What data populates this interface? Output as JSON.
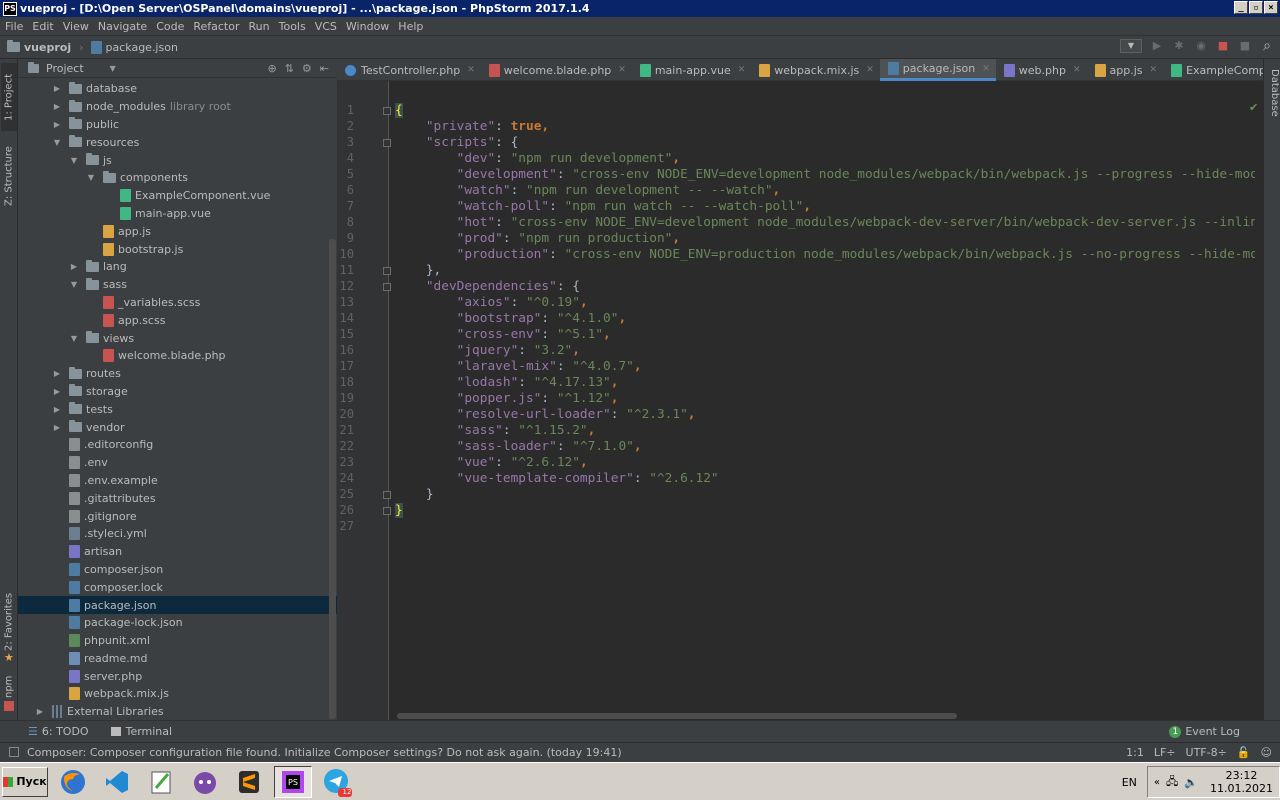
{
  "window": {
    "app_icon_text": "PS",
    "title": "vueproj - [D:\\Open Server\\OSPanel\\domains\\vueproj] - ...\\package.json - PhpStorm 2017.1.4",
    "btn_min": "_",
    "btn_restore": "▫",
    "btn_close": "×"
  },
  "menu": [
    "File",
    "Edit",
    "View",
    "Navigate",
    "Code",
    "Refactor",
    "Run",
    "Tools",
    "VCS",
    "Window",
    "Help"
  ],
  "breadcrumb": {
    "project": "vueproj",
    "file": "package.json"
  },
  "left_tabs": {
    "project": "1: Project",
    "structure": "Z: Structure",
    "favorites": "2: Favorites",
    "npm": "npm"
  },
  "right_tabs": {
    "database": "Database"
  },
  "project_panel": {
    "title": "Project"
  },
  "tree": [
    {
      "label": "database",
      "hint": "",
      "type": "folder",
      "depth": 1,
      "arrow": "▶"
    },
    {
      "label": "node_modules",
      "hint": "library root",
      "type": "folder",
      "depth": 1,
      "arrow": "▶"
    },
    {
      "label": "public",
      "hint": "",
      "type": "folder",
      "depth": 1,
      "arrow": "▶"
    },
    {
      "label": "resources",
      "hint": "",
      "type": "folder",
      "depth": 1,
      "arrow": "▼"
    },
    {
      "label": "js",
      "hint": "",
      "type": "folder",
      "depth": 2,
      "arrow": "▼"
    },
    {
      "label": "components",
      "hint": "",
      "type": "folder",
      "depth": 3,
      "arrow": "▼"
    },
    {
      "label": "ExampleComponent.vue",
      "hint": "",
      "type": "vue",
      "depth": 4,
      "arrow": ""
    },
    {
      "label": "main-app.vue",
      "hint": "",
      "type": "vue",
      "depth": 4,
      "arrow": ""
    },
    {
      "label": "app.js",
      "hint": "",
      "type": "js",
      "depth": 3,
      "arrow": ""
    },
    {
      "label": "bootstrap.js",
      "hint": "",
      "type": "js",
      "depth": 3,
      "arrow": ""
    },
    {
      "label": "lang",
      "hint": "",
      "type": "folder",
      "depth": 2,
      "arrow": "▶"
    },
    {
      "label": "sass",
      "hint": "",
      "type": "folder",
      "depth": 2,
      "arrow": "▼"
    },
    {
      "label": "_variables.scss",
      "hint": "",
      "type": "scss",
      "depth": 3,
      "arrow": ""
    },
    {
      "label": "app.scss",
      "hint": "",
      "type": "scss",
      "depth": 3,
      "arrow": ""
    },
    {
      "label": "views",
      "hint": "",
      "type": "folder",
      "depth": 2,
      "arrow": "▼"
    },
    {
      "label": "welcome.blade.php",
      "hint": "",
      "type": "blade",
      "depth": 3,
      "arrow": ""
    },
    {
      "label": "routes",
      "hint": "",
      "type": "folder",
      "depth": 1,
      "arrow": "▶"
    },
    {
      "label": "storage",
      "hint": "",
      "type": "folder",
      "depth": 1,
      "arrow": "▶"
    },
    {
      "label": "tests",
      "hint": "",
      "type": "folder",
      "depth": 1,
      "arrow": "▶"
    },
    {
      "label": "vendor",
      "hint": "",
      "type": "folder",
      "depth": 1,
      "arrow": "▶"
    },
    {
      "label": ".editorconfig",
      "hint": "",
      "type": "text",
      "depth": 1,
      "arrow": ""
    },
    {
      "label": ".env",
      "hint": "",
      "type": "text",
      "depth": 1,
      "arrow": ""
    },
    {
      "label": ".env.example",
      "hint": "",
      "type": "text",
      "depth": 1,
      "arrow": ""
    },
    {
      "label": ".gitattributes",
      "hint": "",
      "type": "text",
      "depth": 1,
      "arrow": ""
    },
    {
      "label": ".gitignore",
      "hint": "",
      "type": "text",
      "depth": 1,
      "arrow": ""
    },
    {
      "label": ".styleci.yml",
      "hint": "",
      "type": "yml",
      "depth": 1,
      "arrow": ""
    },
    {
      "label": "artisan",
      "hint": "",
      "type": "php",
      "depth": 1,
      "arrow": ""
    },
    {
      "label": "composer.json",
      "hint": "",
      "type": "json",
      "depth": 1,
      "arrow": ""
    },
    {
      "label": "composer.lock",
      "hint": "",
      "type": "json",
      "depth": 1,
      "arrow": ""
    },
    {
      "label": "package.json",
      "hint": "",
      "type": "json",
      "depth": 1,
      "arrow": "",
      "selected": true
    },
    {
      "label": "package-lock.json",
      "hint": "",
      "type": "json",
      "depth": 1,
      "arrow": ""
    },
    {
      "label": "phpunit.xml",
      "hint": "",
      "type": "xml",
      "depth": 1,
      "arrow": ""
    },
    {
      "label": "readme.md",
      "hint": "",
      "type": "md",
      "depth": 1,
      "arrow": ""
    },
    {
      "label": "server.php",
      "hint": "",
      "type": "php",
      "depth": 1,
      "arrow": ""
    },
    {
      "label": "webpack.mix.js",
      "hint": "",
      "type": "js",
      "depth": 1,
      "arrow": ""
    },
    {
      "label": "External Libraries",
      "hint": "",
      "type": "lib",
      "depth": 0,
      "arrow": "▶"
    }
  ],
  "editor_tabs": [
    {
      "label": "TestController.php",
      "type": "class"
    },
    {
      "label": "welcome.blade.php",
      "type": "blade"
    },
    {
      "label": "main-app.vue",
      "type": "vue"
    },
    {
      "label": "webpack.mix.js",
      "type": "js"
    },
    {
      "label": "package.json",
      "type": "json",
      "active": true
    },
    {
      "label": "web.php",
      "type": "php"
    },
    {
      "label": "app.js",
      "type": "js"
    },
    {
      "label": "ExampleComponent.vue",
      "type": "vue"
    }
  ],
  "code_lines": [
    [
      {
        "t": "{",
        "c": "brace"
      }
    ],
    [
      {
        "t": "    "
      },
      {
        "t": "\"private\"",
        "c": "k"
      },
      {
        "t": ": ",
        "c": "p"
      },
      {
        "t": "true",
        "c": "b"
      },
      {
        "t": ",",
        "c": "b"
      }
    ],
    [
      {
        "t": "    "
      },
      {
        "t": "\"scripts\"",
        "c": "k"
      },
      {
        "t": ": {",
        "c": "p"
      }
    ],
    [
      {
        "t": "        "
      },
      {
        "t": "\"dev\"",
        "c": "k"
      },
      {
        "t": ": ",
        "c": "p"
      },
      {
        "t": "\"npm run development\"",
        "c": "s"
      },
      {
        "t": ",",
        "c": "b"
      }
    ],
    [
      {
        "t": "        "
      },
      {
        "t": "\"development\"",
        "c": "k"
      },
      {
        "t": ": ",
        "c": "p"
      },
      {
        "t": "\"cross-env NODE_ENV=development node_modules/webpack/bin/webpack.js --progress --hide-modules --con",
        "c": "s"
      }
    ],
    [
      {
        "t": "        "
      },
      {
        "t": "\"watch\"",
        "c": "k"
      },
      {
        "t": ": ",
        "c": "p"
      },
      {
        "t": "\"npm run development -- --watch\"",
        "c": "s"
      },
      {
        "t": ",",
        "c": "b"
      }
    ],
    [
      {
        "t": "        "
      },
      {
        "t": "\"watch-poll\"",
        "c": "k"
      },
      {
        "t": ": ",
        "c": "p"
      },
      {
        "t": "\"npm run watch -- --watch-poll\"",
        "c": "s"
      },
      {
        "t": ",",
        "c": "b"
      }
    ],
    [
      {
        "t": "        "
      },
      {
        "t": "\"hot\"",
        "c": "k"
      },
      {
        "t": ": ",
        "c": "p"
      },
      {
        "t": "\"cross-env NODE_ENV=development node_modules/webpack-dev-server/bin/webpack-dev-server.js --inline --hot --",
        "c": "s"
      }
    ],
    [
      {
        "t": "        "
      },
      {
        "t": "\"prod\"",
        "c": "k"
      },
      {
        "t": ": ",
        "c": "p"
      },
      {
        "t": "\"npm run production\"",
        "c": "s"
      },
      {
        "t": ",",
        "c": "b"
      }
    ],
    [
      {
        "t": "        "
      },
      {
        "t": "\"production\"",
        "c": "k"
      },
      {
        "t": ": ",
        "c": "p"
      },
      {
        "t": "\"cross-env NODE_ENV=production node_modules/webpack/bin/webpack.js --no-progress --hide-modules --co",
        "c": "s"
      }
    ],
    [
      {
        "t": "    "
      },
      {
        "t": "},",
        "c": "p"
      }
    ],
    [
      {
        "t": "    "
      },
      {
        "t": "\"devDependencies\"",
        "c": "k"
      },
      {
        "t": ": {",
        "c": "p"
      }
    ],
    [
      {
        "t": "        "
      },
      {
        "t": "\"axios\"",
        "c": "k"
      },
      {
        "t": ": ",
        "c": "p"
      },
      {
        "t": "\"^0.19\"",
        "c": "s"
      },
      {
        "t": ",",
        "c": "b"
      }
    ],
    [
      {
        "t": "        "
      },
      {
        "t": "\"bootstrap\"",
        "c": "k"
      },
      {
        "t": ": ",
        "c": "p"
      },
      {
        "t": "\"^4.1.0\"",
        "c": "s"
      },
      {
        "t": ",",
        "c": "b"
      }
    ],
    [
      {
        "t": "        "
      },
      {
        "t": "\"cross-env\"",
        "c": "k"
      },
      {
        "t": ": ",
        "c": "p"
      },
      {
        "t": "\"^5.1\"",
        "c": "s"
      },
      {
        "t": ",",
        "c": "b"
      }
    ],
    [
      {
        "t": "        "
      },
      {
        "t": "\"jquery\"",
        "c": "k"
      },
      {
        "t": ": ",
        "c": "p"
      },
      {
        "t": "\"3.2\"",
        "c": "s"
      },
      {
        "t": ",",
        "c": "b"
      }
    ],
    [
      {
        "t": "        "
      },
      {
        "t": "\"laravel-mix\"",
        "c": "k"
      },
      {
        "t": ": ",
        "c": "p"
      },
      {
        "t": "\"^4.0.7\"",
        "c": "s"
      },
      {
        "t": ",",
        "c": "b"
      }
    ],
    [
      {
        "t": "        "
      },
      {
        "t": "\"lodash\"",
        "c": "k"
      },
      {
        "t": ": ",
        "c": "p"
      },
      {
        "t": "\"^4.17.13\"",
        "c": "s"
      },
      {
        "t": ",",
        "c": "b"
      }
    ],
    [
      {
        "t": "        "
      },
      {
        "t": "\"popper.js\"",
        "c": "k"
      },
      {
        "t": ": ",
        "c": "p"
      },
      {
        "t": "\"^1.12\"",
        "c": "s"
      },
      {
        "t": ",",
        "c": "b"
      }
    ],
    [
      {
        "t": "        "
      },
      {
        "t": "\"resolve-url-loader\"",
        "c": "k"
      },
      {
        "t": ": ",
        "c": "p"
      },
      {
        "t": "\"^2.3.1\"",
        "c": "s"
      },
      {
        "t": ",",
        "c": "b"
      }
    ],
    [
      {
        "t": "        "
      },
      {
        "t": "\"sass\"",
        "c": "k"
      },
      {
        "t": ": ",
        "c": "p"
      },
      {
        "t": "\"^1.15.2\"",
        "c": "s"
      },
      {
        "t": ",",
        "c": "b"
      }
    ],
    [
      {
        "t": "        "
      },
      {
        "t": "\"sass-loader\"",
        "c": "k"
      },
      {
        "t": ": ",
        "c": "p"
      },
      {
        "t": "\"^7.1.0\"",
        "c": "s"
      },
      {
        "t": ",",
        "c": "b"
      }
    ],
    [
      {
        "t": "        "
      },
      {
        "t": "\"vue\"",
        "c": "k"
      },
      {
        "t": ": ",
        "c": "p"
      },
      {
        "t": "\"^2.6.12\"",
        "c": "s"
      },
      {
        "t": ",",
        "c": "b"
      }
    ],
    [
      {
        "t": "        "
      },
      {
        "t": "\"vue-template-compiler\"",
        "c": "k"
      },
      {
        "t": ": ",
        "c": "p"
      },
      {
        "t": "\"^2.6.12\"",
        "c": "s"
      }
    ],
    [
      {
        "t": "    "
      },
      {
        "t": "}",
        "c": "p"
      }
    ],
    [
      {
        "t": "}",
        "c": "brace"
      }
    ],
    []
  ],
  "bottom_tools": {
    "todo": "6: TODO",
    "terminal": "Terminal",
    "event_log": "Event Log",
    "event_count": "1"
  },
  "status": {
    "message": "Composer: Composer configuration file found. Initialize Composer settings? Do not ask again. (today 19:41)",
    "position": "1:1",
    "line_sep": "LF÷",
    "encoding": "UTF-8÷"
  },
  "taskbar": {
    "start_label": "Пуск",
    "apps": [
      "firefox",
      "vscode",
      "notepad",
      "cat-app",
      "sublime",
      "phpstorm",
      "telegram"
    ],
    "telegram_badge": "12",
    "lang": "EN",
    "time": "23:12",
    "date": "11.01.2021"
  },
  "colors": {
    "accent": "#4a88c7",
    "selection": "#0d293e",
    "title_bar": "#0a246a"
  }
}
